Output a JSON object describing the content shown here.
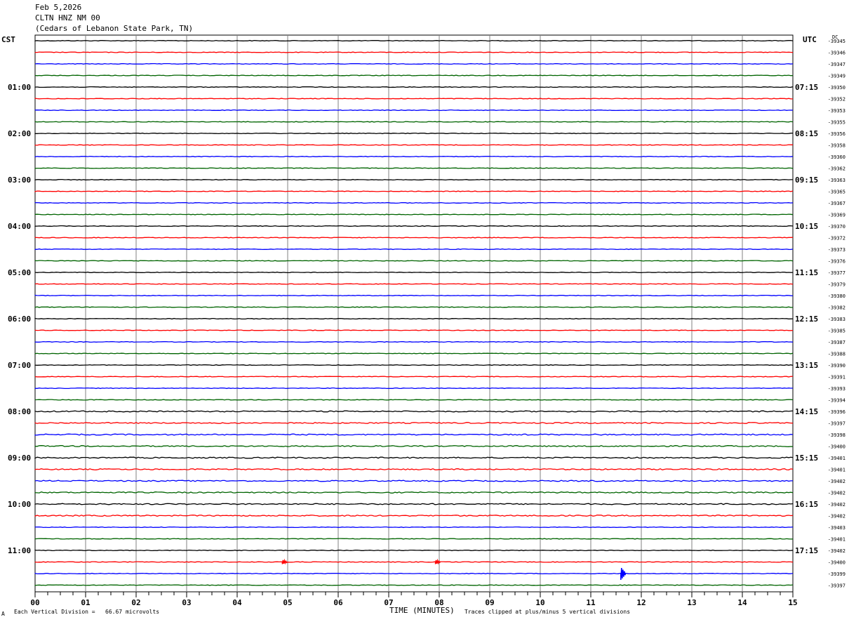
{
  "header": {
    "date": "Feb 5,2026",
    "station": "CLTN HNZ NM 00",
    "location": "(Cedars of Lebanon State Park, TN)"
  },
  "left_tz": "CST",
  "right_tz": "UTC",
  "dc_label": "DC",
  "footer": {
    "scale_note": "Each Vertical Division =   66.67 microvolts",
    "clip_note": "Traces clipped at plus/minus 5 vertical divisions",
    "mark": "A"
  },
  "colors": {
    "black": "#000000",
    "red": "#ff0000",
    "blue": "#0000ff",
    "green": "#006400",
    "grid": "#808080"
  },
  "chart_data": {
    "type": "line",
    "title": "",
    "xlabel": "TIME (MINUTES)",
    "x_ticks": [
      "00",
      "01",
      "02",
      "03",
      "04",
      "05",
      "06",
      "07",
      "08",
      "09",
      "10",
      "11",
      "12",
      "13",
      "14",
      "15"
    ],
    "xlim": [
      0,
      15
    ],
    "trace_colors": [
      "black",
      "red",
      "blue",
      "green"
    ],
    "left_hour_labels": [
      "01:00",
      "02:00",
      "03:00",
      "04:00",
      "05:00",
      "06:00",
      "07:00",
      "08:00",
      "09:00",
      "10:00",
      "11:00"
    ],
    "right_hour_labels": [
      "07:15",
      "08:15",
      "09:15",
      "10:15",
      "11:15",
      "12:15",
      "13:15",
      "14:15",
      "15:15",
      "16:15",
      "17:15"
    ],
    "dc_offsets": [
      "-39345",
      "-39346",
      "-39347",
      "-39349",
      "-39350",
      "-39352",
      "-39353",
      "-39355",
      "-39356",
      "-39358",
      "-39360",
      "-39362",
      "-39363",
      "-39365",
      "-39367",
      "-39369",
      "-39370",
      "-39372",
      "-39373",
      "-39376",
      "-39377",
      "-39379",
      "-39380",
      "-39382",
      "-39383",
      "-39385",
      "-39387",
      "-39388",
      "-39390",
      "-39391",
      "-39393",
      "-39394",
      "-39396",
      "-39397",
      "-39398",
      "-39400",
      "-39401",
      "-39401",
      "-39402",
      "-39402",
      "-39402",
      "-39402",
      "-39403",
      "-39401",
      "-39402",
      "-39400",
      "-39399",
      "-39397"
    ],
    "events": [
      {
        "trace": 45,
        "minute": 4.95,
        "amplitude": 3
      },
      {
        "trace": 45,
        "minute": 7.98,
        "amplitude": 3
      },
      {
        "trace": 46,
        "minute": 11.65,
        "amplitude": 9
      }
    ]
  }
}
